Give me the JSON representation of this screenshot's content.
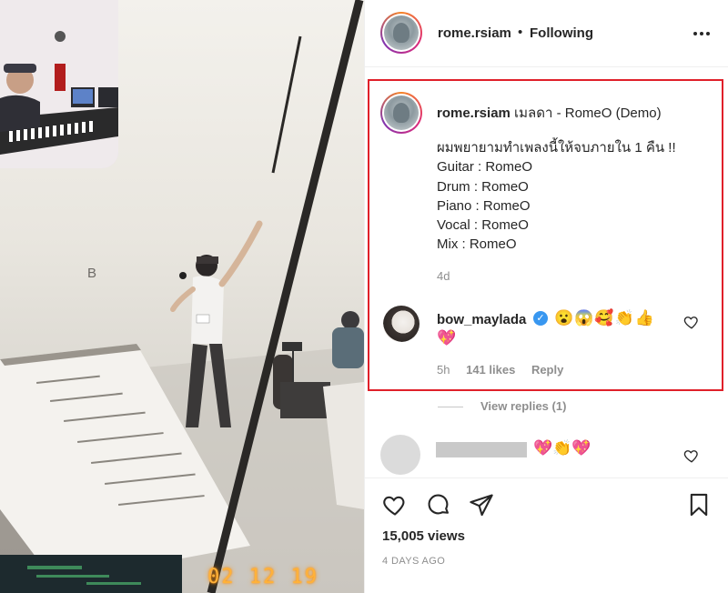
{
  "media": {
    "date_stamp": "02 12 19",
    "sign_letter": "B"
  },
  "post": {
    "username": "rome.rsiam",
    "follow_dot": "•",
    "follow_status": "Following",
    "more_icon": "more-options-icon"
  },
  "caption": {
    "username": "rome.rsiam",
    "title": "เมลดา - RomeO (Demo)",
    "body": "ผมพยายามทำเพลงนี้ให้จบภายใน 1 คืน !!\nGuitar : RomeO\nDrum : RomeO\nPiano : RomeO\nVocal : RomeO\nMix : RomeO",
    "age": "4d"
  },
  "comment": {
    "username": "bow_maylada",
    "verified": "✓",
    "emojis": "😮😱🥰👏👍",
    "emojis_line2": "💖",
    "age": "5h",
    "likes": "141 likes",
    "reply": "Reply"
  },
  "replies": {
    "label": "View replies (1)"
  },
  "comment2": {
    "emojis": "💖👏💖"
  },
  "footer": {
    "views": "15,005 views",
    "posted": "4 DAYS AGO"
  },
  "colors": {
    "highlight_border": "#e0202a",
    "verified": "#3897f0",
    "muted_text": "#8e8e8e"
  }
}
